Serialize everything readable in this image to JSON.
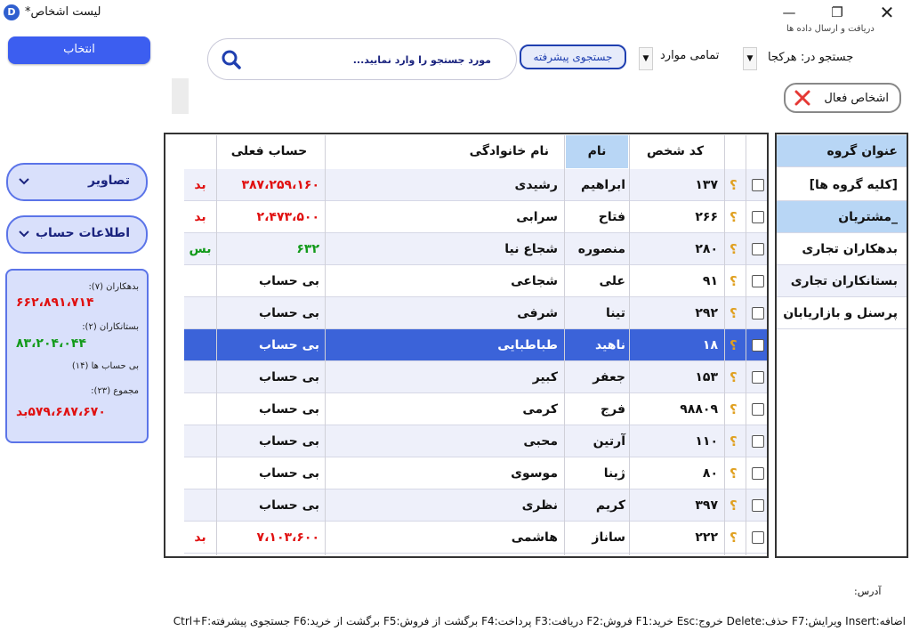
{
  "window": {
    "title": "لیست اشخاص*",
    "app_icon": "app-logo-icon",
    "controls": [
      "minimize-icon",
      "maximize-icon",
      "close-icon"
    ]
  },
  "header": {
    "sync_label": "دریافت و ارسال داده ها",
    "search_in_label": "جستجو در:",
    "search_in_value": "هرکجا",
    "filter_value": "تمامی موارد",
    "advanced_search_label": "جستجوی پیشرفته",
    "search_placeholder": "مورد جستجو را وارد نمایید...",
    "search_value": "",
    "active_people_label": "اشخاص فعال"
  },
  "left_panel": {
    "select_button": "انتخاب",
    "images_label": "تصاویر",
    "account_info_label": "اطلاعات حساب",
    "summary": {
      "debtors_label": "بدهکاران (۷):",
      "debtors_value": "۶۶۲،۸۹۱،۷۱۴",
      "creditors_label": "بستانکاران (۲):",
      "creditors_value": "۸۳،۲۰۴،۰۴۴",
      "no_account_label": "بی حساب ها (۱۴)",
      "total_label": "مجموع (۲۳):",
      "total_value": "۵۷۹،۶۸۷،۶۷۰بد"
    }
  },
  "table": {
    "columns": [
      "کد شخص",
      "نام",
      "نام خانوادگی",
      "حساب فعلی"
    ],
    "rows": [
      {
        "code": "۱۳۷",
        "first": "ابراهیم",
        "last": "رشیدی",
        "balance": "۳۸۷،۲۵۹،۱۶۰",
        "status": "بد"
      },
      {
        "code": "۲۶۶",
        "first": "فتاح",
        "last": "سرابی",
        "balance": "۲،۴۷۳،۵۰۰",
        "status": "بد"
      },
      {
        "code": "۲۸۰",
        "first": "منصوره",
        "last": "شجاع نیا",
        "balance": "۶۳۲",
        "status": "بس"
      },
      {
        "code": "۹۱",
        "first": "علی",
        "last": "شجاعی",
        "balance": "بی حساب",
        "status": ""
      },
      {
        "code": "۲۹۲",
        "first": "تینا",
        "last": "شرفی",
        "balance": "بی حساب",
        "status": ""
      },
      {
        "code": "۱۸",
        "first": "ناهید",
        "last": "طباطبایی",
        "balance": "بی حساب",
        "status": ""
      },
      {
        "code": "۱۵۳",
        "first": "جعفر",
        "last": "کبیر",
        "balance": "بی حساب",
        "status": ""
      },
      {
        "code": "۹۸۸۰۹",
        "first": "فرج",
        "last": "کرمی",
        "balance": "بی حساب",
        "status": ""
      },
      {
        "code": "۱۱۰",
        "first": "آرتین",
        "last": "محبی",
        "balance": "بی حساب",
        "status": ""
      },
      {
        "code": "۸۰",
        "first": "ژینا",
        "last": "موسوی",
        "balance": "بی حساب",
        "status": ""
      },
      {
        "code": "۳۹۷",
        "first": "کریم",
        "last": "نظری",
        "balance": "بی حساب",
        "status": ""
      },
      {
        "code": "۲۲۲",
        "first": "ساناز",
        "last": "هاشمی",
        "balance": "۷،۱۰۳،۶۰۰",
        "status": "بد"
      }
    ],
    "row_marker": "؟"
  },
  "groups": {
    "header": "عنوان گروه",
    "items": [
      "[کلیه گروه ها]",
      "_مشتریان",
      "بدهکاران تجاری",
      "بستانکاران تجاری",
      "پرسنل و بازاریابان"
    ]
  },
  "footer": {
    "address_label": "آدرس:",
    "shortcuts": "اضافه:Insert  ویرایش:F7  حذف:Delete  خروج:Esc  خرید:F1  فروش:F2  دریافت:F3  پرداخت:F4  برگشت از فروش:F5  برگشت از خرید:F6  جستجوی پیشرفته:Ctrl+F"
  },
  "colors": {
    "accent": "#3c5ef0",
    "selected_row": "#3b63d9",
    "debtor": "#e01010",
    "creditor": "#129a1a",
    "group_highlight": "#b8d6f5"
  }
}
